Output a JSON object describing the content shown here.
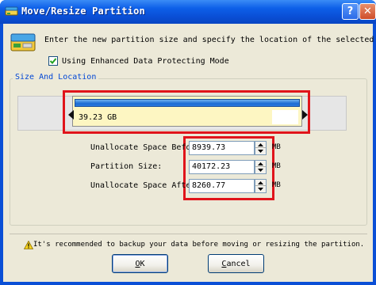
{
  "window": {
    "title": "Move/Resize Partition"
  },
  "titlebar": {
    "help_label": "?",
    "close_label": "✕"
  },
  "instruction": "Enter the new partition size and specify the location of the selected partition.",
  "enhanced_mode": {
    "checked": true,
    "label": "Using Enhanced Data Protecting Mode"
  },
  "size_location": {
    "group_title": "Size And Location",
    "partition_size_label": "39.23 GB",
    "fields": [
      {
        "label": "Unallocate Space Before:",
        "value": "8939.73",
        "unit": "MB"
      },
      {
        "label": "Partition Size:",
        "value": "40172.23",
        "unit": "MB"
      },
      {
        "label": "Unallocate Space After:",
        "value": "8260.77",
        "unit": "MB"
      }
    ]
  },
  "warning": "It's recommended to backup your data before moving or resizing the partition.",
  "buttons": {
    "ok_accel": "O",
    "ok_rest": "K",
    "cancel_accel": "C",
    "cancel_rest": "ancel"
  },
  "colors": {
    "titlebar": "#0a4fd6",
    "highlight_box": "#e0141b",
    "partition_bar": "#1c6cd3",
    "dialog_bg": "#ece9d8"
  },
  "icons": [
    "partition-tool-icon",
    "partition-disk-icon",
    "warning-icon",
    "help-icon",
    "close-icon"
  ]
}
